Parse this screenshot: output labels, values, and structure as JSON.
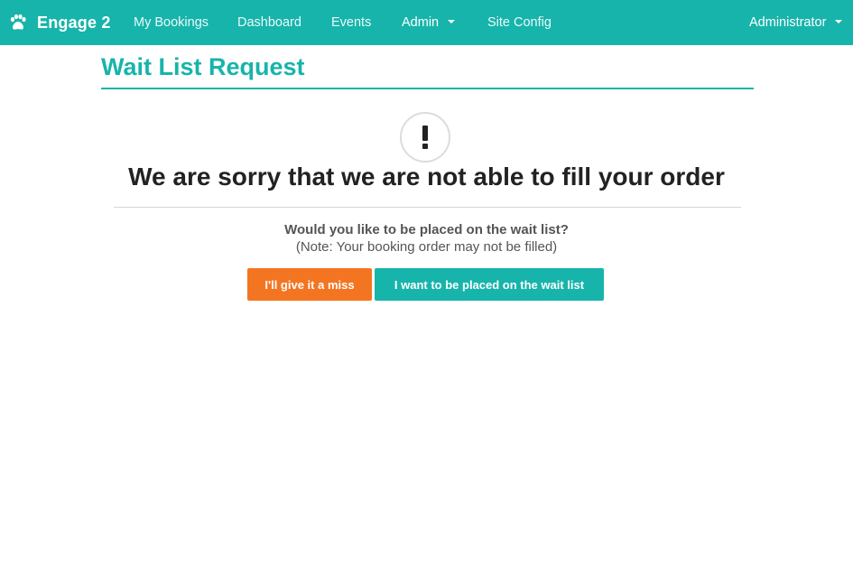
{
  "navbar": {
    "brand": "Engage 2",
    "brand_icon": "paw-icon",
    "bg_color": "#17b4ab",
    "items": [
      {
        "label": "My Bookings"
      },
      {
        "label": "Dashboard"
      },
      {
        "label": "Events"
      },
      {
        "label": "Admin",
        "dropdown": true
      },
      {
        "label": "Site Config"
      }
    ],
    "user": {
      "label": "Administrator",
      "dropdown": true
    }
  },
  "page": {
    "title": "Wait List Request",
    "alert_icon": "exclamation-icon",
    "heading": "We are sorry that we are not able to fill your order",
    "question": "Would you like to be placed on the wait list?",
    "note": "(Note: Your booking order may not be filled)"
  },
  "actions": {
    "decline_label": "I'll give it a miss",
    "decline_color": "#f47521",
    "accept_label": "I want to be placed on the wait list",
    "accept_color": "#17b4ab"
  }
}
